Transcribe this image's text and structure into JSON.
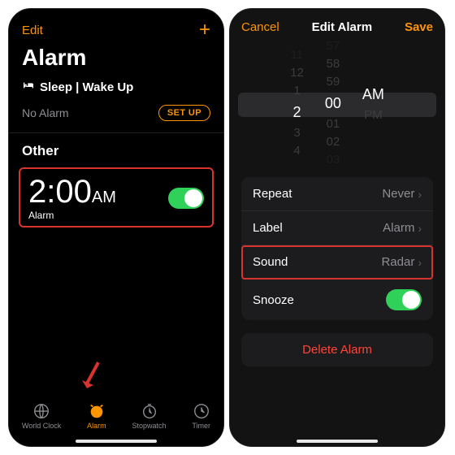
{
  "left": {
    "edit": "Edit",
    "title": "Alarm",
    "sleep_label": "Sleep | Wake Up",
    "no_alarm": "No Alarm",
    "setup": "SET UP",
    "other": "Other",
    "alarm_time": "2:00",
    "alarm_ampm": "AM",
    "alarm_label": "Alarm",
    "tabs": {
      "world_clock": "World Clock",
      "alarm": "Alarm",
      "stopwatch": "Stopwatch",
      "timer": "Timer"
    }
  },
  "right": {
    "cancel": "Cancel",
    "title": "Edit Alarm",
    "save": "Save",
    "picker": {
      "hours": [
        "11",
        "12",
        "1",
        "2",
        "3",
        "4"
      ],
      "minutes": [
        "57",
        "58",
        "59",
        "00",
        "01",
        "02",
        "03"
      ],
      "ampm": [
        "AM",
        "PM"
      ],
      "sel_hour": "2",
      "sel_min": "00",
      "sel_ampm": "AM"
    },
    "rows": {
      "repeat": {
        "k": "Repeat",
        "v": "Never"
      },
      "label": {
        "k": "Label",
        "v": "Alarm"
      },
      "sound": {
        "k": "Sound",
        "v": "Radar"
      },
      "snooze": {
        "k": "Snooze"
      }
    },
    "delete": "Delete Alarm"
  }
}
